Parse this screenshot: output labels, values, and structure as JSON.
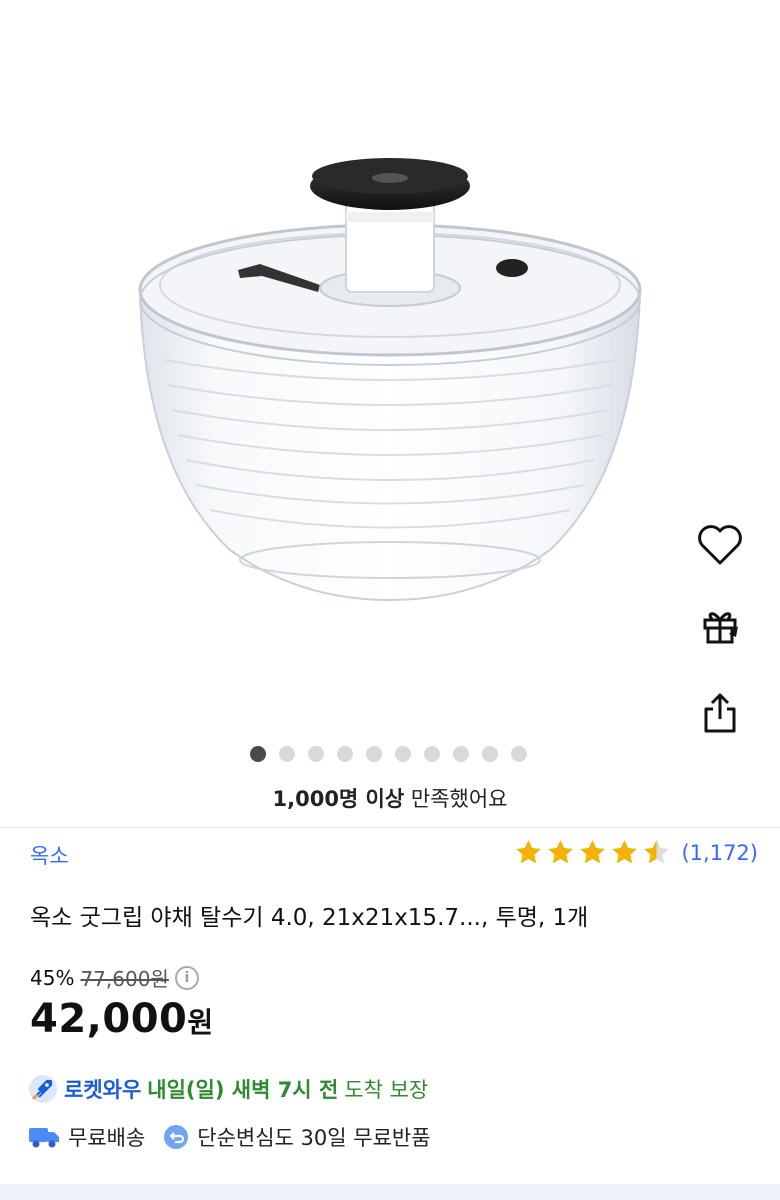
{
  "carousel": {
    "total": 10,
    "active_index": 0
  },
  "side_actions": {
    "wishlist": "heart-icon",
    "gift": "gift-icon",
    "share": "share-icon"
  },
  "satisfaction": {
    "strong": "1,000명 이상",
    "rest": "만족했어요"
  },
  "product": {
    "brand": "옥소",
    "title": "옥소 굿그립 야채 탈수기 4.0, 21x21x15.7..., 투명, 1개",
    "rating_value": 4.5,
    "review_count": "(1,172)"
  },
  "price": {
    "discount": "45%",
    "original": "77,600원",
    "current": "42,000",
    "currency": "원"
  },
  "delivery": {
    "rocket_label": "로켓와우",
    "eta_bold": "내일(일) 새벽 7시 전",
    "eta_rest": "도착 보장"
  },
  "perks": {
    "free_shipping": "무료배송",
    "free_return": "단순변심도 30일 무료반품"
  },
  "colors": {
    "accent": "#346aff",
    "star": "#f5b301",
    "green": "#2e8b2e",
    "rocket_blue": "#1b5cdb"
  }
}
